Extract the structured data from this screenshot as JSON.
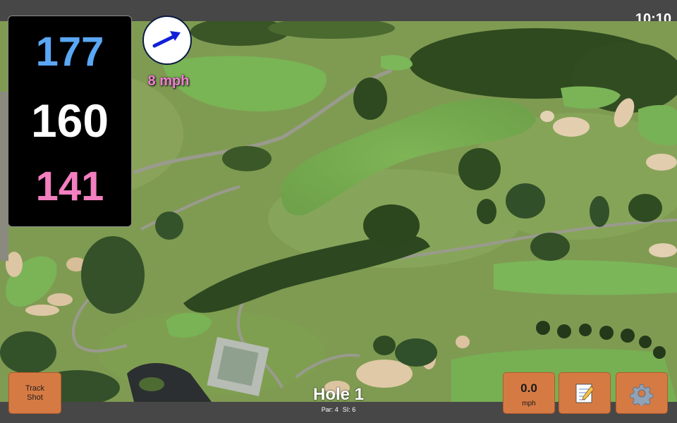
{
  "status_bar": {
    "time": "10:10"
  },
  "distances": {
    "back": "177",
    "center": "160",
    "front": "141",
    "colors": {
      "back": "#5aa7f5",
      "center": "#ffffff",
      "front": "#f37ec0"
    }
  },
  "wind": {
    "speed_label": "8 mph",
    "direction_icon": "arrow-northeast-icon",
    "arrow_color": "#1020d8"
  },
  "track_shot": {
    "label": "Track\nShot"
  },
  "speed": {
    "value": "0.0",
    "unit": "mph"
  },
  "toolbar": {
    "notes_icon": "notepad-icon",
    "settings_icon": "gear-icon",
    "button_color": "#d67a44"
  },
  "hole": {
    "title": "Hole 1",
    "par": "Par: 4",
    "stroke_index": "SI: 6"
  }
}
